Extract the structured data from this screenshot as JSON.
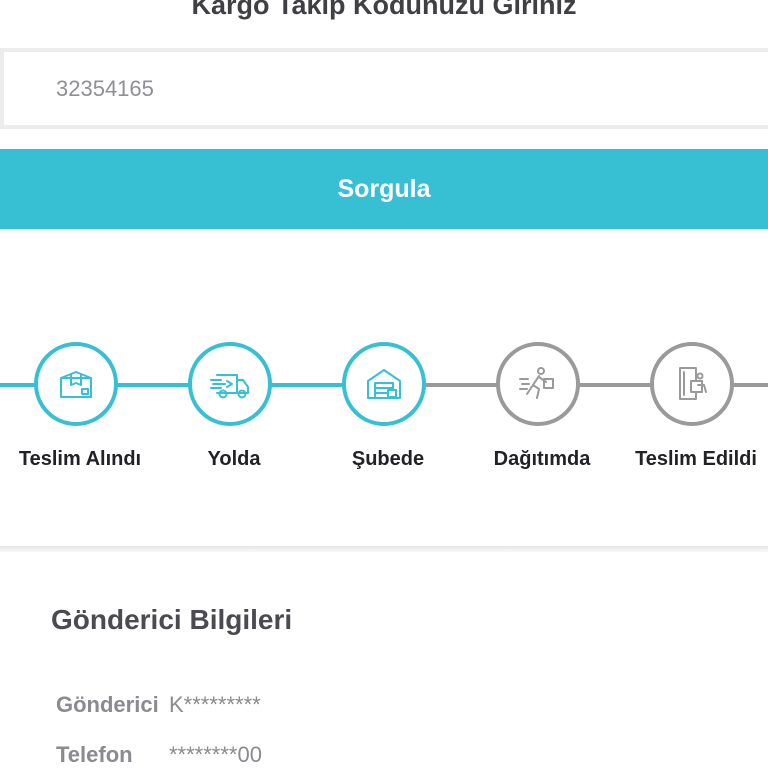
{
  "header": {
    "title": "Kargo Takip Kodunuzu Giriniz"
  },
  "search": {
    "value": "32354165",
    "button_label": "Sorgula"
  },
  "colors": {
    "accent": "#37c0d4",
    "inactive": "#9a9a9a"
  },
  "timeline": {
    "steps": [
      {
        "label": "Teslim Alındı",
        "icon": "package-icon",
        "status": "completed"
      },
      {
        "label": "Yolda",
        "icon": "delivery-truck-icon",
        "status": "completed"
      },
      {
        "label": "Şubede",
        "icon": "warehouse-icon",
        "status": "completed"
      },
      {
        "label": "Dağıtımda",
        "icon": "courier-running-icon",
        "status": "pending"
      },
      {
        "label": "Teslim Edildi",
        "icon": "delivered-door-icon",
        "status": "pending"
      }
    ]
  },
  "sender": {
    "title": "Gönderici Bilgileri",
    "rows": [
      {
        "label": "Gönderici",
        "value": "K*********"
      },
      {
        "label": "Telefon",
        "value": "********00"
      }
    ]
  }
}
